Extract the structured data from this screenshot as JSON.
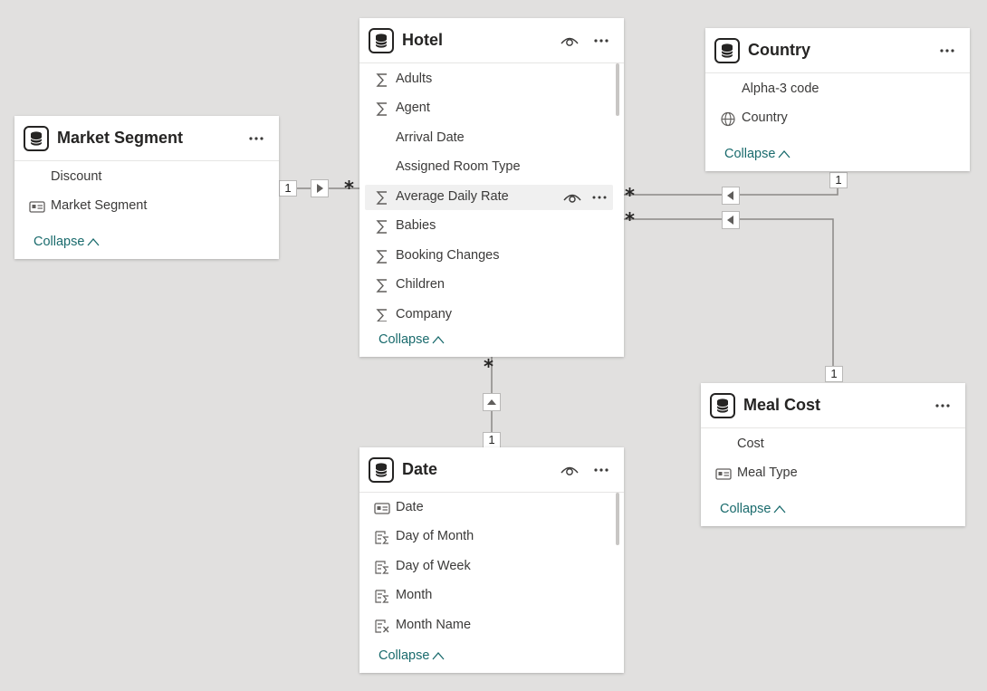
{
  "tables": {
    "hotel": {
      "title": "Hotel",
      "fields": [
        {
          "label": "Adults",
          "icon": "sum-icon"
        },
        {
          "label": "Agent",
          "icon": "sum-icon"
        },
        {
          "label": "Arrival Date",
          "icon": ""
        },
        {
          "label": "Assigned Room Type",
          "icon": ""
        },
        {
          "label": "Average Daily Rate",
          "icon": "sum-icon"
        },
        {
          "label": "Babies",
          "icon": "sum-icon"
        },
        {
          "label": "Booking Changes",
          "icon": "sum-icon"
        },
        {
          "label": "Children",
          "icon": "sum-icon"
        },
        {
          "label": "Company",
          "icon": "sum-icon"
        }
      ],
      "collapse_label": "Collapse"
    },
    "market_segment": {
      "title": "Market Segment",
      "fields": [
        {
          "label": "Discount",
          "icon": ""
        },
        {
          "label": "Market Segment",
          "icon": "id-card-icon"
        }
      ],
      "collapse_label": "Collapse"
    },
    "country": {
      "title": "Country",
      "fields": [
        {
          "label": "Alpha-3 code",
          "icon": ""
        },
        {
          "label": "Country",
          "icon": "globe-icon"
        }
      ],
      "collapse_label": "Collapse"
    },
    "meal_cost": {
      "title": "Meal Cost",
      "fields": [
        {
          "label": "Cost",
          "icon": ""
        },
        {
          "label": "Meal Type",
          "icon": "id-card-icon"
        }
      ],
      "collapse_label": "Collapse"
    },
    "date": {
      "title": "Date",
      "fields": [
        {
          "label": "Date",
          "icon": "id-card-icon"
        },
        {
          "label": "Day of Month",
          "icon": "hierarchy-sum-icon"
        },
        {
          "label": "Day of Week",
          "icon": "hierarchy-sum-icon"
        },
        {
          "label": "Month",
          "icon": "hierarchy-sum-icon"
        },
        {
          "label": "Month Name",
          "icon": "hierarchy-calc-icon"
        }
      ],
      "collapse_label": "Collapse"
    }
  },
  "relationships": {
    "one": "1",
    "many": "*"
  }
}
